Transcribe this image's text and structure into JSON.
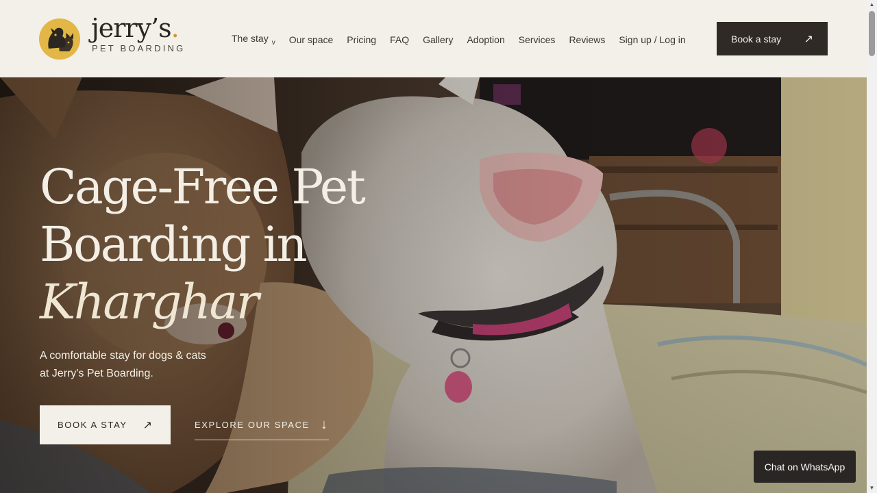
{
  "brand": {
    "name": "jerry’s",
    "name_dot": ".",
    "tagline": "PET BOARDING",
    "badge_icon": "dog-and-cat-logo-icon",
    "badge_color": "#e3b745"
  },
  "nav": {
    "items": [
      {
        "label": "The stay",
        "has_dropdown": true,
        "chevron": "v"
      },
      {
        "label": "Our space"
      },
      {
        "label": "Pricing"
      },
      {
        "label": "FAQ"
      },
      {
        "label": "Gallery"
      },
      {
        "label": "Adoption"
      },
      {
        "label": "Services"
      },
      {
        "label": "Reviews"
      },
      {
        "label": "Sign up / Log in"
      }
    ],
    "cta_label": "Book a stay",
    "cta_arrow": "↗"
  },
  "hero": {
    "title_line1": "Cage-Free Pet",
    "title_line2": "Boarding in",
    "title_line3": "Kharghar",
    "subtitle_line1": "A comfortable stay for dogs & cats",
    "subtitle_line2": "at Jerry's Pet Boarding.",
    "primary_button": "BOOK A STAY",
    "primary_arrow": "↗",
    "secondary_button": "EXPLORE OUR SPACE",
    "secondary_arrow": "↓",
    "background": "photo-of-orange-and-white-cats"
  },
  "chat": {
    "label": "Chat on WhatsApp"
  },
  "colors": {
    "header_bg": "#f3f0ea",
    "dark": "#2f2a26",
    "accent_gold": "#e3b745"
  }
}
